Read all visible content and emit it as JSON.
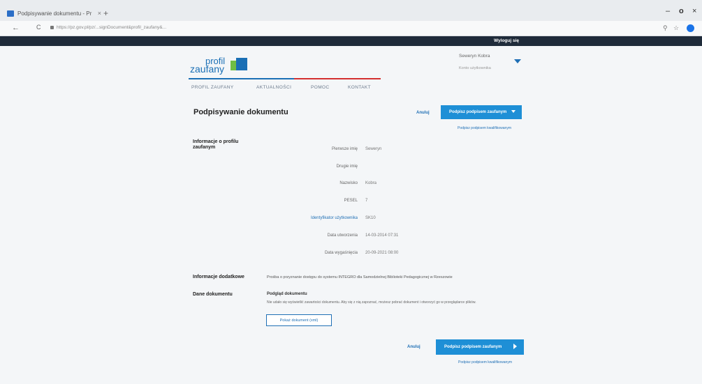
{
  "browser": {
    "tab_title": "Podpisywanie dokumentu - Pr",
    "tab_close": "×",
    "new_tab": "+",
    "url": "https://pz.gov.pl/pz/...signDocument&profil_zaufany&...",
    "window_min": "–",
    "window_max": "o",
    "window_close": "×",
    "back": "←",
    "reload": "C",
    "search_icon": "search-icon",
    "star_icon": "star-icon",
    "profile_icon": "profile-icon"
  },
  "site_bar": {
    "logout_label": "Wyloguj się"
  },
  "logo": {
    "line1": "profil",
    "line2": "zaufany"
  },
  "user": {
    "name": "Seweryn Kobra",
    "sub": "Konto użytkownika"
  },
  "menu": {
    "items": [
      "PROFIL ZAUFANY",
      "AKTUALNOŚCI",
      "POMOC",
      "KONTAKT"
    ]
  },
  "main": {
    "title": "Podpisywanie dokumentu",
    "cancel_label": "Anuluj",
    "sign_label": "Podpisz podpisem zaufanym",
    "qualified_link": "Podpisz podpisem kwalifikowanym",
    "profile_section": "Informacje o profilu zaufanym",
    "fields": [
      {
        "label": "Pierwsze imię",
        "value": "Seweryn"
      },
      {
        "label": "Drugie imię",
        "value": ""
      },
      {
        "label": "Nazwisko",
        "value": "Kobra"
      },
      {
        "label": "PESEL",
        "value": "7"
      },
      {
        "label": "Identyfikator użytkownika",
        "value": "SK10"
      },
      {
        "label": "Data utworzenia",
        "value": "14-03-2014 07:31"
      },
      {
        "label": "Data wygaśnięcia",
        "value": "20-09-2021 08:00"
      }
    ],
    "extra_section": "Informacje dodatkowe",
    "extra_text": "Prośba o przyznanie dostępu do systemu INTEGRO dla Samodzielnej Biblioteki Pedagogicznej w Rzeszowie",
    "doc_section": "Dane dokumentu",
    "doc_title": "Podgląd dokumentu",
    "doc_desc": "Nie udało się wyświetlić zawartości dokumentu. Aby się z nią zapoznać, możesz pobrać dokument i otworzyć go w przeglądarce plików.",
    "show_doc_label": "Pokaż dokument (xml)"
  }
}
